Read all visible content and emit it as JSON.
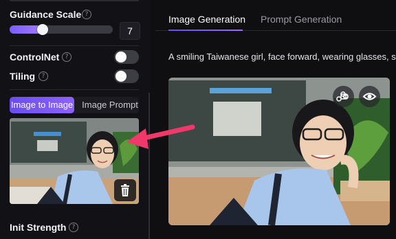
{
  "sidebar": {
    "guidance_scale": {
      "label": "Guidance Scale",
      "value": "7",
      "fill_fraction": 0.32
    },
    "controlnet": {
      "label": "ControlNet",
      "enabled": false
    },
    "tiling": {
      "label": "Tiling",
      "enabled": false
    },
    "source_tabs": [
      {
        "label": "Image to Image",
        "active": true
      },
      {
        "label": "Image Prompt",
        "active": false
      }
    ],
    "init_strength": {
      "label": "Init Strength"
    }
  },
  "main": {
    "tabs": [
      {
        "label": "Image Generation",
        "active": true
      },
      {
        "label": "Prompt Generation",
        "active": false
      }
    ],
    "prompt_text": "A smiling Taiwanese girl, face forward, wearing glasses, sh"
  },
  "colors": {
    "accent": "#7b5cff",
    "arrow": "#f0386b",
    "background": "#0f0f12"
  },
  "icons": [
    "help-icon",
    "trash-icon",
    "command-icon",
    "eye-icon",
    "arrow-icon"
  ]
}
